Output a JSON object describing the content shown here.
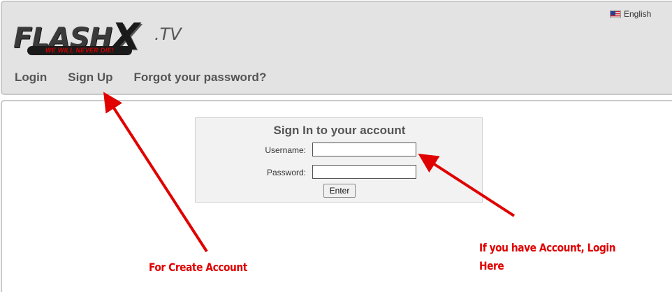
{
  "header": {
    "language": "English",
    "logo": {
      "main": "FLASH",
      "x": "X",
      "tv": ".TV",
      "tagline": "WE WILL NEVER DIE!"
    },
    "nav": [
      {
        "label": "Login"
      },
      {
        "label": "Sign Up"
      },
      {
        "label": "Forgot your password?"
      }
    ]
  },
  "login": {
    "title": "Sign In to your account",
    "username_label": "Username:",
    "username_value": "",
    "password_label": "Password:",
    "password_value": "",
    "enter_label": "Enter"
  },
  "annotations": {
    "create_account": "For Create Account",
    "login_here": "If you have Account, Login Here",
    "color": "#e00000"
  }
}
